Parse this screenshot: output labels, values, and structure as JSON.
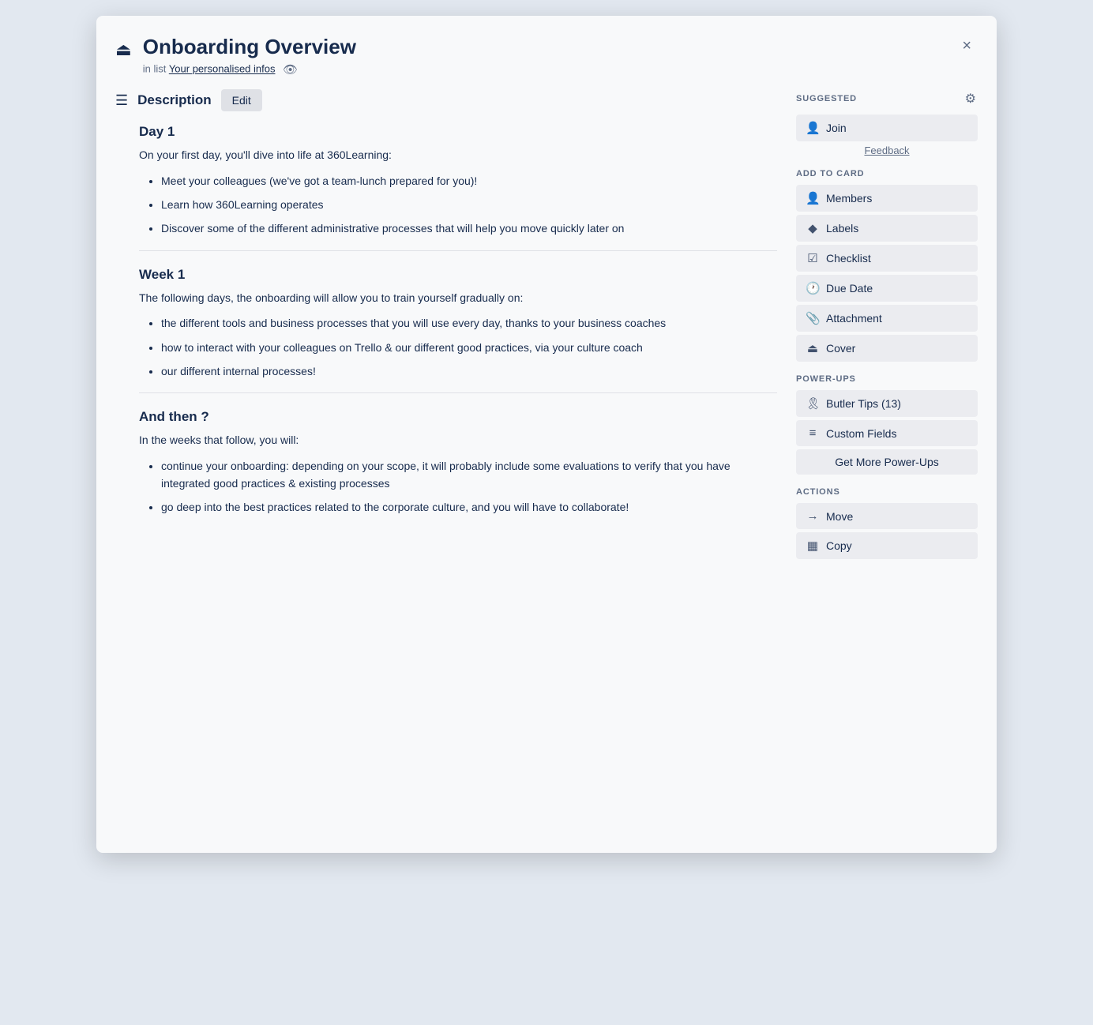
{
  "modal": {
    "title": "Onboarding Overview",
    "subtitle_prefix": "in list",
    "list_link": "Your personalised infos",
    "close_label": "×"
  },
  "description": {
    "heading": "Description",
    "edit_label": "Edit",
    "sections": [
      {
        "title": "Day 1",
        "intro": "On your first day, you'll dive into life at 360Learning:",
        "items": [
          "Meet your colleagues (we've got a team-lunch prepared for you)!",
          "Learn how 360Learning operates",
          "Discover some of the different administrative processes that will help you move quickly later on"
        ]
      },
      {
        "title": "Week 1",
        "intro": "The following days, the onboarding will allow you to train yourself gradually on:",
        "items": [
          "the different tools and business processes that you will use every day, thanks to your business coaches",
          "how to interact with your colleagues on Trello & our different good practices, via your culture coach",
          "our different internal processes!"
        ]
      },
      {
        "title": "And then ?",
        "intro": "In the weeks that follow, you will:",
        "items": [
          "continue your onboarding: depending on your scope, it will probably include some evaluations to verify that you have integrated good practices & existing processes",
          "go deep into the best practices related to the corporate culture, and you will have to collaborate!"
        ]
      }
    ]
  },
  "sidebar": {
    "suggested_title": "SUGGESTED",
    "suggested_buttons": [
      {
        "label": "Join",
        "icon": "person"
      }
    ],
    "feedback_label": "Feedback",
    "add_to_card_title": "ADD TO CARD",
    "add_to_card_buttons": [
      {
        "label": "Members",
        "icon": "person"
      },
      {
        "label": "Labels",
        "icon": "label"
      },
      {
        "label": "Checklist",
        "icon": "check"
      },
      {
        "label": "Due Date",
        "icon": "clock"
      },
      {
        "label": "Attachment",
        "icon": "paperclip"
      },
      {
        "label": "Cover",
        "icon": "cover"
      }
    ],
    "powerups_title": "POWER-UPS",
    "powerups_buttons": [
      {
        "label": "Butler Tips (13)",
        "icon": "butler"
      },
      {
        "label": "Custom Fields",
        "icon": "fields"
      }
    ],
    "get_more_label": "Get More Power-Ups",
    "actions_title": "ACTIONS",
    "actions_buttons": [
      {
        "label": "Move",
        "icon": "arrow"
      },
      {
        "label": "Copy",
        "icon": "copy"
      }
    ]
  }
}
